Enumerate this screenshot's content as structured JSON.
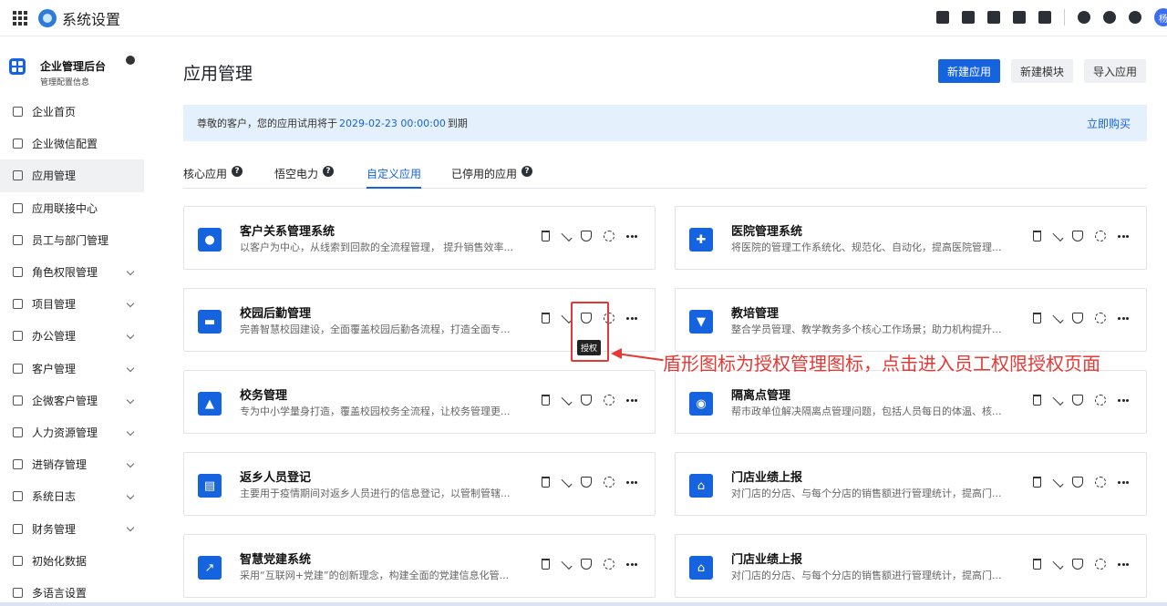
{
  "topbar": {
    "app_title": "系统设置",
    "avatar_text": "杨"
  },
  "sidebar": {
    "brand_name": "企业管理后台",
    "brand_sub": "管理配置信息",
    "items": [
      {
        "label": "企业首页",
        "icon": "home-icon",
        "chevron": false
      },
      {
        "label": "企业微信配置",
        "icon": "wechat-icon",
        "chevron": false
      },
      {
        "label": "应用管理",
        "icon": "apps-icon",
        "chevron": false,
        "active": true
      },
      {
        "label": "应用联接中心",
        "icon": "connect-icon",
        "chevron": false
      },
      {
        "label": "员工与部门管理",
        "icon": "users-icon",
        "chevron": false
      },
      {
        "label": "角色权限管理",
        "icon": "role-icon",
        "chevron": true
      },
      {
        "label": "项目管理",
        "icon": "project-icon",
        "chevron": true
      },
      {
        "label": "办公管理",
        "icon": "office-icon",
        "chevron": true
      },
      {
        "label": "客户管理",
        "icon": "customer-icon",
        "chevron": true
      },
      {
        "label": "企微客户管理",
        "icon": "wecom-customer-icon",
        "chevron": true
      },
      {
        "label": "人力资源管理",
        "icon": "hr-icon",
        "chevron": true
      },
      {
        "label": "进销存管理",
        "icon": "inventory-icon",
        "chevron": true
      },
      {
        "label": "系统日志",
        "icon": "log-icon",
        "chevron": true
      },
      {
        "label": "财务管理",
        "icon": "finance-icon",
        "chevron": true
      },
      {
        "label": "初始化数据",
        "icon": "init-icon",
        "chevron": false
      },
      {
        "label": "多语言设置",
        "icon": "language-icon",
        "chevron": false
      }
    ]
  },
  "main": {
    "title": "应用管理",
    "buttons": {
      "new_app": "新建应用",
      "new_module": "新建模块",
      "import_app": "导入应用"
    },
    "notice": {
      "prefix": "尊敬的客户，您的应用试用将于",
      "date": "2029-02-23 00:00:00",
      "suffix": "到期",
      "buy": "立即购买"
    },
    "tabs": [
      {
        "label": "核心应用",
        "help": true
      },
      {
        "label": "悟空电力",
        "help": true
      },
      {
        "label": "自定义应用",
        "help": false,
        "active": true
      },
      {
        "label": "已停用的应用",
        "help": true
      }
    ],
    "cards": [
      {
        "title": "客户关系管理系统",
        "desc": "以客户为中心，从线索到回款的全流程管理， 提升销售效率...",
        "icon": "user-icon"
      },
      {
        "title": "医院管理系统",
        "desc": "将医院的管理工作系统化、规范化、自动化，提高医院管理...",
        "icon": "medkit-icon"
      },
      {
        "title": "校园后勤管理",
        "desc": "完善智慧校园建设，全面覆盖校园后勤各流程，打造全面专...",
        "icon": "tray-icon"
      },
      {
        "title": "教培管理",
        "desc": "整合学员管理、教学教务多个核心工作场景；助力机构提升...",
        "icon": "tie-icon"
      },
      {
        "title": "校务管理",
        "desc": "专为中小学量身打造，覆盖校园校务全流程，让校务管理更...",
        "icon": "graduation-cap-icon"
      },
      {
        "title": "隔离点管理",
        "desc": "帮市政单位解决隔离点管理问题，包括人员每日的体温、核...",
        "icon": "isolation-icon"
      },
      {
        "title": "返乡人员登记",
        "desc": "主要用于疫情期间对返乡人员进行的信息登记，以管制管辖...",
        "icon": "clipboard-icon"
      },
      {
        "title": "门店业绩上报",
        "desc": "对门店的分店、与每个分店的销售额进行管理统计，提高门...",
        "icon": "store-icon"
      },
      {
        "title": "智慧党建系统",
        "desc": "采用“互联网+党建”的创新理念，构建全面的党建信息化管...",
        "icon": "chart-icon"
      },
      {
        "title": "门店业绩上报",
        "desc": "对门店的分店、与每个分店的销售额进行管理统计，提高门...",
        "icon": "store-icon"
      }
    ],
    "tooltip": "授权",
    "annotation": "盾形图标为授权管理图标，点击进入员工权限授权页面"
  },
  "colors": {
    "primary": "#1663e0",
    "annotation": "#e53935",
    "notice_bg": "#e5f0fd"
  }
}
